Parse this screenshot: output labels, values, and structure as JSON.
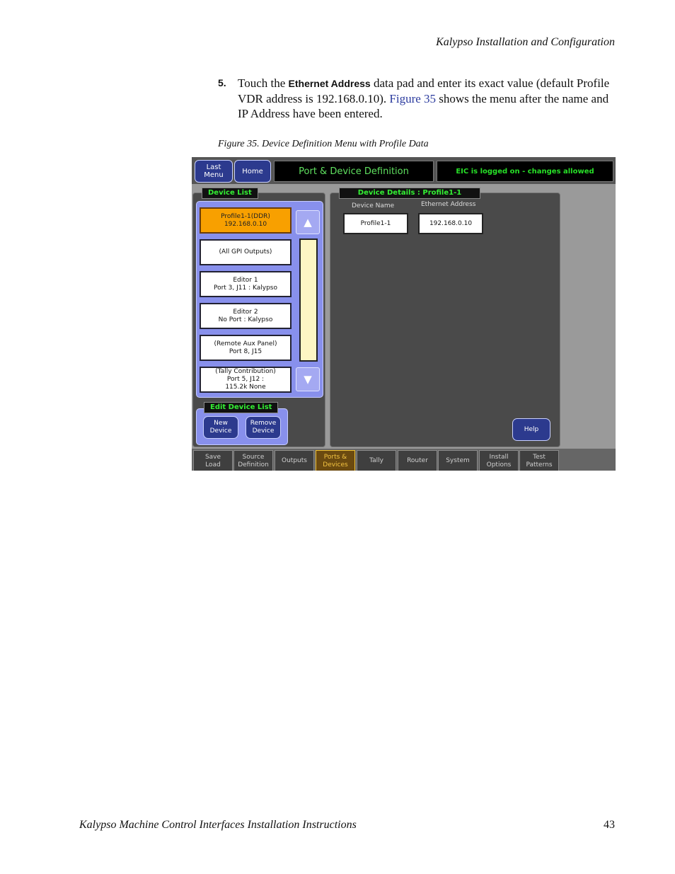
{
  "header": {
    "running_title": "Kalypso Installation and Configuration"
  },
  "step": {
    "number": "5.",
    "text_before": "Touch the ",
    "bold_term": "Ethernet Address",
    "text_middle": " data pad and enter its exact value (default Profile VDR address is 192.168.0.10). ",
    "figure_link": "Figure 35",
    "text_after": " shows the menu after the name and IP Address have been entered."
  },
  "figure": {
    "caption": "Figure 35.  Device Definition Menu with Profile Data"
  },
  "screen": {
    "buttons": {
      "last_menu": [
        "Last",
        "Menu"
      ],
      "home": "Home"
    },
    "title": "Port & Device Definition",
    "status": "EIC is logged on - changes allowed",
    "device_list": {
      "label": "Device List",
      "items": [
        [
          "Profile1-1(DDR)",
          "192.168.0.10"
        ],
        [
          "(All GPI Outputs)"
        ],
        [
          "Editor 1",
          "Port 3, J11 : Kalypso"
        ],
        [
          "Editor 2",
          "No Port : Kalypso"
        ],
        [
          "(Remote Aux Panel)",
          "Port 8, J15"
        ],
        [
          "(Tally Contribution)",
          "Port 5, J12 :",
          "115.2k None"
        ]
      ]
    },
    "edit_list": {
      "label": "Edit Device List",
      "new": [
        "New",
        "Device"
      ],
      "remove": [
        "Remove",
        "Device"
      ]
    },
    "details": {
      "label": "Device Details : Profile1-1",
      "name_label": "Device Name",
      "name_value": "Profile1-1",
      "addr_label": "Ethernet Address",
      "addr_value": "192.168.0.10"
    },
    "help": "Help",
    "tabs": [
      [
        "Save",
        "Load"
      ],
      [
        "Source",
        "Definition"
      ],
      [
        "Outputs"
      ],
      [
        "Ports &",
        "Devices"
      ],
      [
        "Tally"
      ],
      [
        "Router"
      ],
      [
        "System"
      ],
      [
        "Install",
        "Options"
      ],
      [
        "Test",
        "Patterns"
      ]
    ],
    "active_tab_index": 3
  },
  "footer": {
    "title": "Kalypso Machine Control Interfaces Installation Instructions",
    "page": "43"
  }
}
